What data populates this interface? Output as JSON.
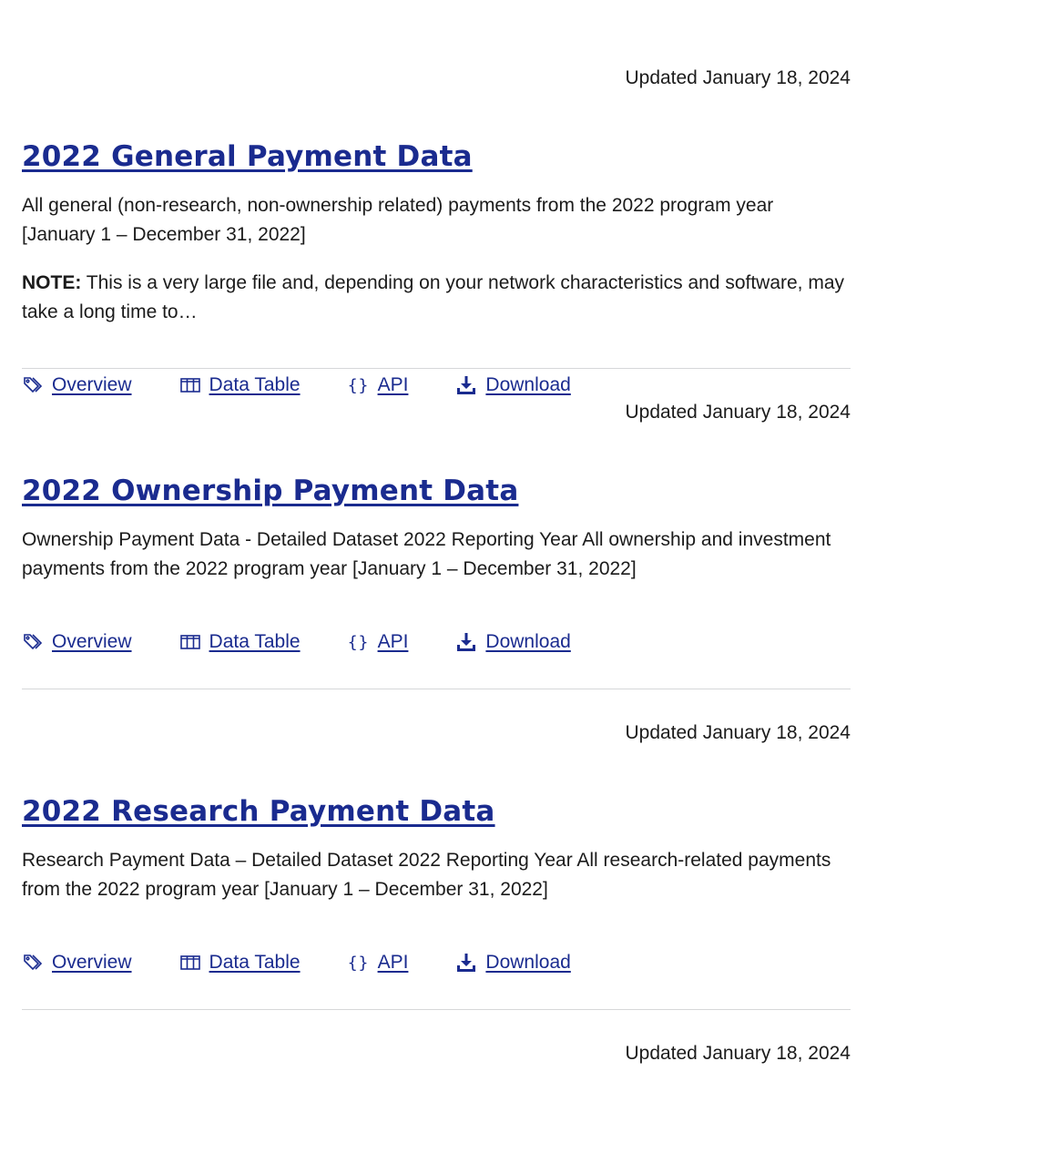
{
  "datasets": [
    {
      "updated": "Updated January 18, 2024",
      "title": "2022 General Payment Data",
      "description": "All general (non-research, non-ownership related) payments from the 2022 program year [January 1 – December 31, 2022]",
      "note_label": "NOTE:",
      "note_text": " This is a very large file and, depending on your network characteristics and software, may take a long time to…",
      "actions": {
        "overview": "Overview",
        "data_table": "Data Table",
        "api": "API",
        "download": "Download"
      }
    },
    {
      "updated": "Updated January 18, 2024",
      "title": "2022 Ownership Payment Data",
      "description": "Ownership Payment Data - Detailed Dataset 2022 Reporting Year All ownership and investment payments from the 2022 program year [January 1 – December 31, 2022]",
      "actions": {
        "overview": "Overview",
        "data_table": "Data Table",
        "api": "API",
        "download": "Download"
      }
    },
    {
      "updated": "Updated January 18, 2024",
      "title": "2022 Research Payment Data",
      "description": "Research Payment Data – Detailed Dataset 2022 Reporting Year All research-related payments from the 2022 program year [January 1 – December 31, 2022]",
      "actions": {
        "overview": "Overview",
        "data_table": "Data Table",
        "api": "API",
        "download": "Download"
      }
    }
  ],
  "next_updated": "Updated January 18, 2024",
  "icons": {
    "overview": "tag-icon",
    "data_table": "table-columns-icon",
    "api": "curly-braces-icon",
    "download": "download-icon"
  },
  "colors": {
    "link": "#1a2b8f",
    "text": "#1b1b1b",
    "divider": "#d6d7d9"
  }
}
